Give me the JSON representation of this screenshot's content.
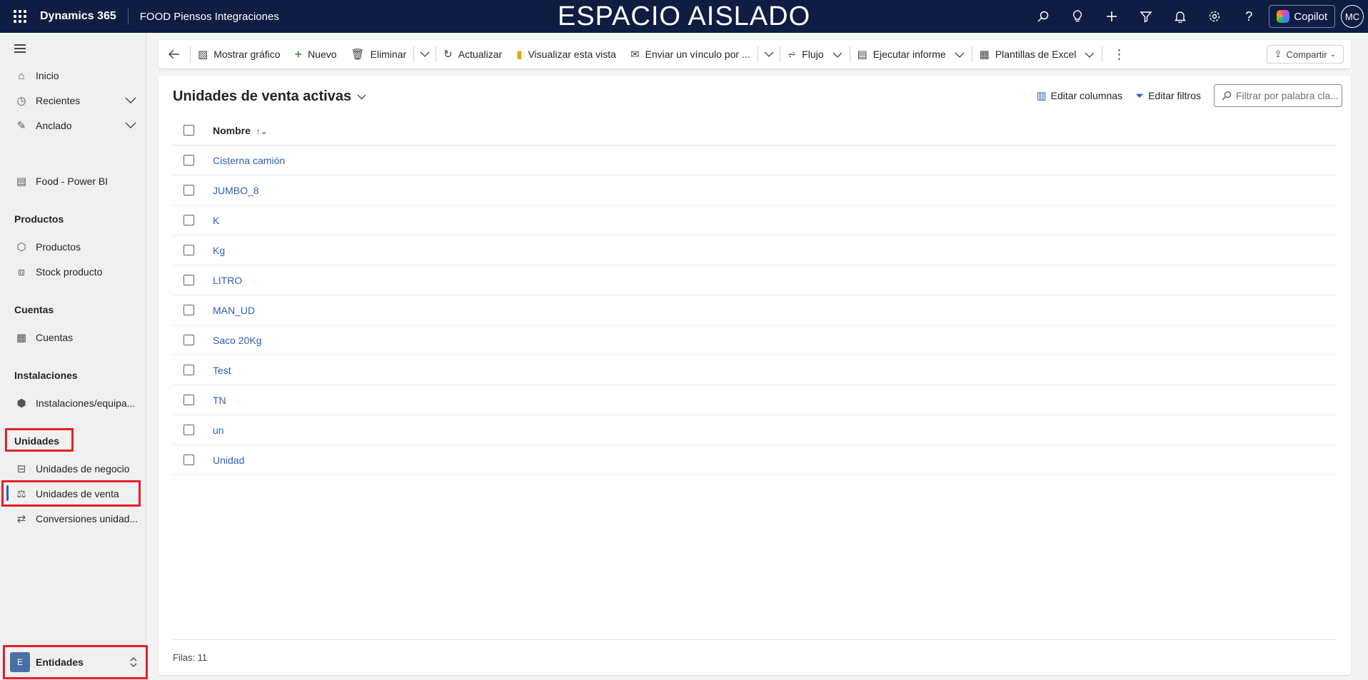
{
  "topbar": {
    "brand": "Dynamics 365",
    "app_name": "FOOD Piensos Integraciones",
    "environment_banner": "ESPACIO AISLADO",
    "copilot_label": "Copilot",
    "user_initials": "MC",
    "icons": [
      "waffle-icon",
      "search-icon",
      "lightbulb-icon",
      "plus-icon",
      "filter-icon",
      "bell-icon",
      "gear-icon",
      "help-icon"
    ]
  },
  "sidebar": {
    "top_items": [
      {
        "label": "Inicio",
        "icon": "home-icon"
      },
      {
        "label": "Recientes",
        "icon": "clock-icon"
      },
      {
        "label": "Anclado",
        "icon": "pin-icon"
      }
    ],
    "power_bi": {
      "label": "Food - Power BI",
      "icon": "report-icon"
    },
    "sections": [
      {
        "title": "Productos",
        "items": [
          {
            "label": "Productos"
          },
          {
            "label": "Stock producto"
          }
        ]
      },
      {
        "title": "Cuentas",
        "items": [
          {
            "label": "Cuentas"
          }
        ]
      },
      {
        "title": "Instalaciones",
        "items": [
          {
            "label": "Instalaciones/equipa..."
          }
        ]
      },
      {
        "title": "Unidades",
        "items": [
          {
            "label": "Unidades de negocio"
          },
          {
            "label": "Unidades de venta"
          },
          {
            "label": "Conversiones unidad..."
          }
        ]
      }
    ],
    "area": {
      "badge": "E",
      "label": "Entidades"
    }
  },
  "commandbar": {
    "show_chart": "Mostrar gráfico",
    "new": "Nuevo",
    "delete": "Eliminar",
    "refresh": "Actualizar",
    "visualize": "Visualizar esta vista",
    "send_link": "Enviar un vínculo por ...",
    "flow": "Flujo",
    "run_report": "Ejecutar informe",
    "excel_templates": "Plantillas de Excel",
    "share": "Compartir"
  },
  "view": {
    "title": "Unidades de venta activas",
    "edit_columns": "Editar columnas",
    "edit_filters": "Editar filtros",
    "search_placeholder": "Filtrar por palabra cla...",
    "column_header": "Nombre",
    "rows": [
      "Cisterna camión",
      "JUMBO_8",
      "K",
      "Kg",
      "LITRO",
      "MAN_UD",
      "Saco 20Kg",
      "Test",
      "TN",
      "un",
      "Unidad"
    ],
    "row_count_label": "Filas: 11"
  }
}
